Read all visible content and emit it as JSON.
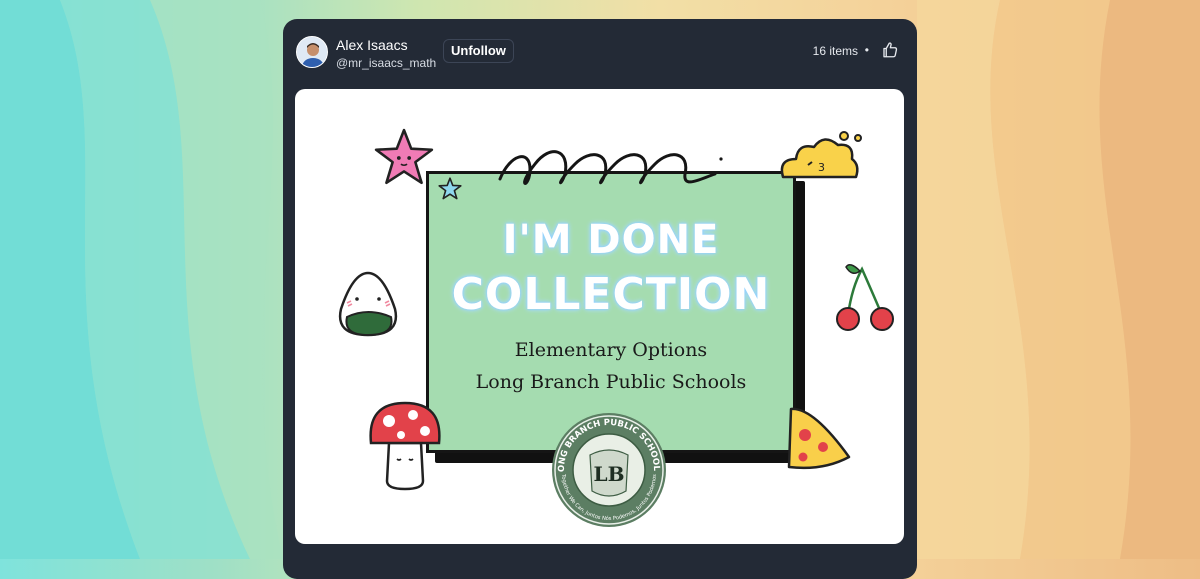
{
  "post": {
    "author_name": "Alex Isaacs",
    "author_handle": "@mr_isaacs_math",
    "follow_button": "Unfollow",
    "items_count": "16 items",
    "separator": "•",
    "like_icon": "thumbs-up-icon"
  },
  "cover": {
    "title_line1": "I'M DONE",
    "title_line2": "COLLECTION",
    "subtitle_line1": "Elementary Options",
    "subtitle_line2": "Long Branch Public Schools",
    "seal_top_text": "LONG BRANCH PUBLIC SCHOOLS",
    "seal_center_text": "LB",
    "seal_bottom_text": "Together We Can, Juntos Nós Podemos, Juntos Podemos"
  },
  "colors": {
    "card_bg": "#232a36",
    "board_green": "#a5dcb0",
    "title_glow": "#8ecfff"
  }
}
